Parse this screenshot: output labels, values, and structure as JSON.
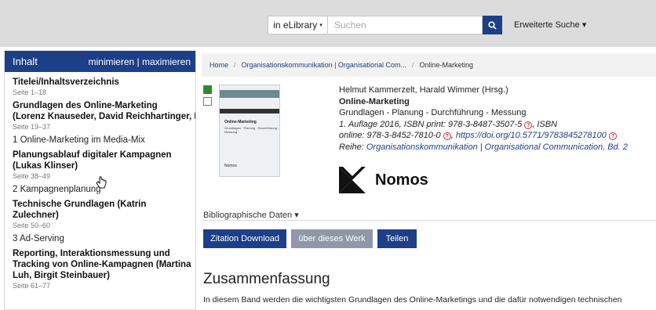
{
  "header": {
    "scope_label": "in eLibrary",
    "search_placeholder": "Suchen",
    "advanced_label": "Erweiterte Suche"
  },
  "sidebar": {
    "title": "Inhalt",
    "controls": "minimieren | maximieren",
    "items": [
      {
        "type": "bold",
        "lines": [
          "Titelei/Inhaltsverzeichnis"
        ],
        "pages": "Seite 1–18"
      },
      {
        "type": "bold",
        "lines": [
          "Grundlagen des Online-Marketing",
          "(Lorenz Knauseder, David Reichhartinger, Ha"
        ],
        "pages": "Seite 19–37"
      },
      {
        "type": "section",
        "label": "1 Online-Marketing im Media-Mix"
      },
      {
        "type": "bold",
        "lines": [
          "Planungsablauf digitaler Kampagnen",
          "(Lukas Klinser)"
        ],
        "pages": "Seite 38–49"
      },
      {
        "type": "section",
        "label": "2 Kampagnenplanung"
      },
      {
        "type": "bold",
        "lines": [
          "Technische Grundlagen (Katrin",
          "Zulechner)"
        ],
        "pages": "Seite 50–60"
      },
      {
        "type": "section",
        "label": "3 Ad-Serving"
      },
      {
        "type": "bold",
        "lines": [
          "Reporting, Interaktionsmessung und",
          "Tracking von Online-Kampagnen (Martina",
          "Luh, Birgit Steinbauer)"
        ],
        "pages": "Seite 61–77"
      }
    ]
  },
  "breadcrumb": {
    "items": [
      "Home",
      "Organisationskommunikation | Organisational Com...",
      "Online-Marketing"
    ]
  },
  "book": {
    "authors": "Helmut Kammerzelt, Harald Wimmer (Hrsg.)",
    "title": "Online-Marketing",
    "subtitle": "Grundlagen - Planung - Durchführung - Messung",
    "edition": "1. Auflage 2016, ISBN print: 978-3-8487-3507-5",
    "isbn_suffix": ", ISBN",
    "online_prefix": "online: 978-3-8452-7810-0",
    "doi_link": "https://doi.org/10.5771/9783845278100",
    "series_prefix": "Reihe: ",
    "series_link": "Organisationskommunikation | Organisational Communication, Bd. 2",
    "publisher": "Nomos",
    "cover_title": "Online-Marketing",
    "cover_subtitle": "Grundlagen · Planung · Durchführung · Messung",
    "cover_publisher": "Nomos"
  },
  "details_toggle": "Bibliographische Daten",
  "actions": {
    "citation": "Zitation Download",
    "about": "über dieses Werk",
    "share": "Teilen"
  },
  "summary": {
    "heading": "Zusammenfassung",
    "text": "In diesem Band werden die wichtigsten Grundlagen des Online-Marketings und die dafür notwendigen technischen"
  },
  "colors": {
    "brand": "#1d3f88",
    "muted_button": "#8f98a8",
    "selected_check": "#2f8a2f"
  }
}
